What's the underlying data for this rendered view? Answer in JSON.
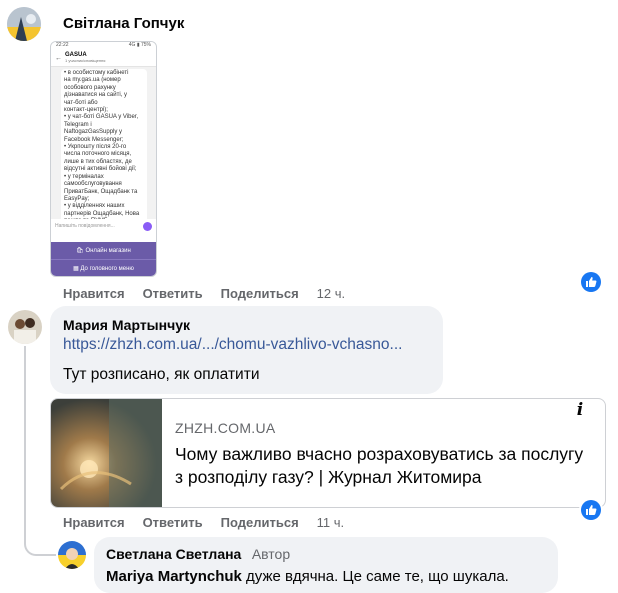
{
  "comment1": {
    "author": "Світлана Гопчук",
    "phone": {
      "status_time": "22:22",
      "status_right": "4G ▮ 75%",
      "chat_name": "GASUA",
      "chat_sub": "1 учасник/сповіщення",
      "message": "• в особистому кабінеті\nна my.gas.ua (номер\nособового рахунку\nдізнаватися на сайті, у\nчат-боті або\nконтакт-центрі);\n• у чат-боті GASUA у Viber,\nTelegram і\nNaftogazGasSupply у\nFacebook Messenger;\n• Укрпошту після 20-го\nчисла поточного місяця,\nлише в тих областях, де\nвідсутні активні бойові дії;\n• у терміналах\nсамообслуговування\nПриватБанк, Ощадбанк та\nEasyPay;\n• у відділеннях наших\nпартнерів Ощадбанк, Нова\nпошта та ПУМБ",
      "input_placeholder": "Напишіть повідомлення...",
      "btn1": "🛍 Онлайн магазин",
      "btn2": "▦ До головного меню"
    },
    "actions": {
      "like": "Нравится",
      "reply": "Ответить",
      "share": "Поделиться",
      "time": "12 ч."
    }
  },
  "comment2": {
    "author": "Мария Мартынчук",
    "link": "https://zhzh.com.ua/.../chomu-vazhlivo-vchasno...",
    "text": "Тут розписано, як оплатити",
    "preview": {
      "domain": "ZHZH.COM.UA",
      "title": "Чому важливо вчасно розраховуватись за послугу з розподілу газу? | Журнал Житомира",
      "info_icon": "i"
    },
    "actions": {
      "like": "Нравится",
      "reply": "Ответить",
      "share": "Поделиться",
      "time": "11 ч."
    }
  },
  "comment3": {
    "author": "Светлана Светлана",
    "author_tag": "Автор",
    "mention": "Mariya Martynchuk",
    "text": " дуже вдячна. Це саме те, що шукала."
  },
  "colors": {
    "like_blue": "#1877f2",
    "bubble": "#f0f2f5",
    "meta_gray": "#65676b",
    "gasua_purple": "#6b5ba8"
  }
}
